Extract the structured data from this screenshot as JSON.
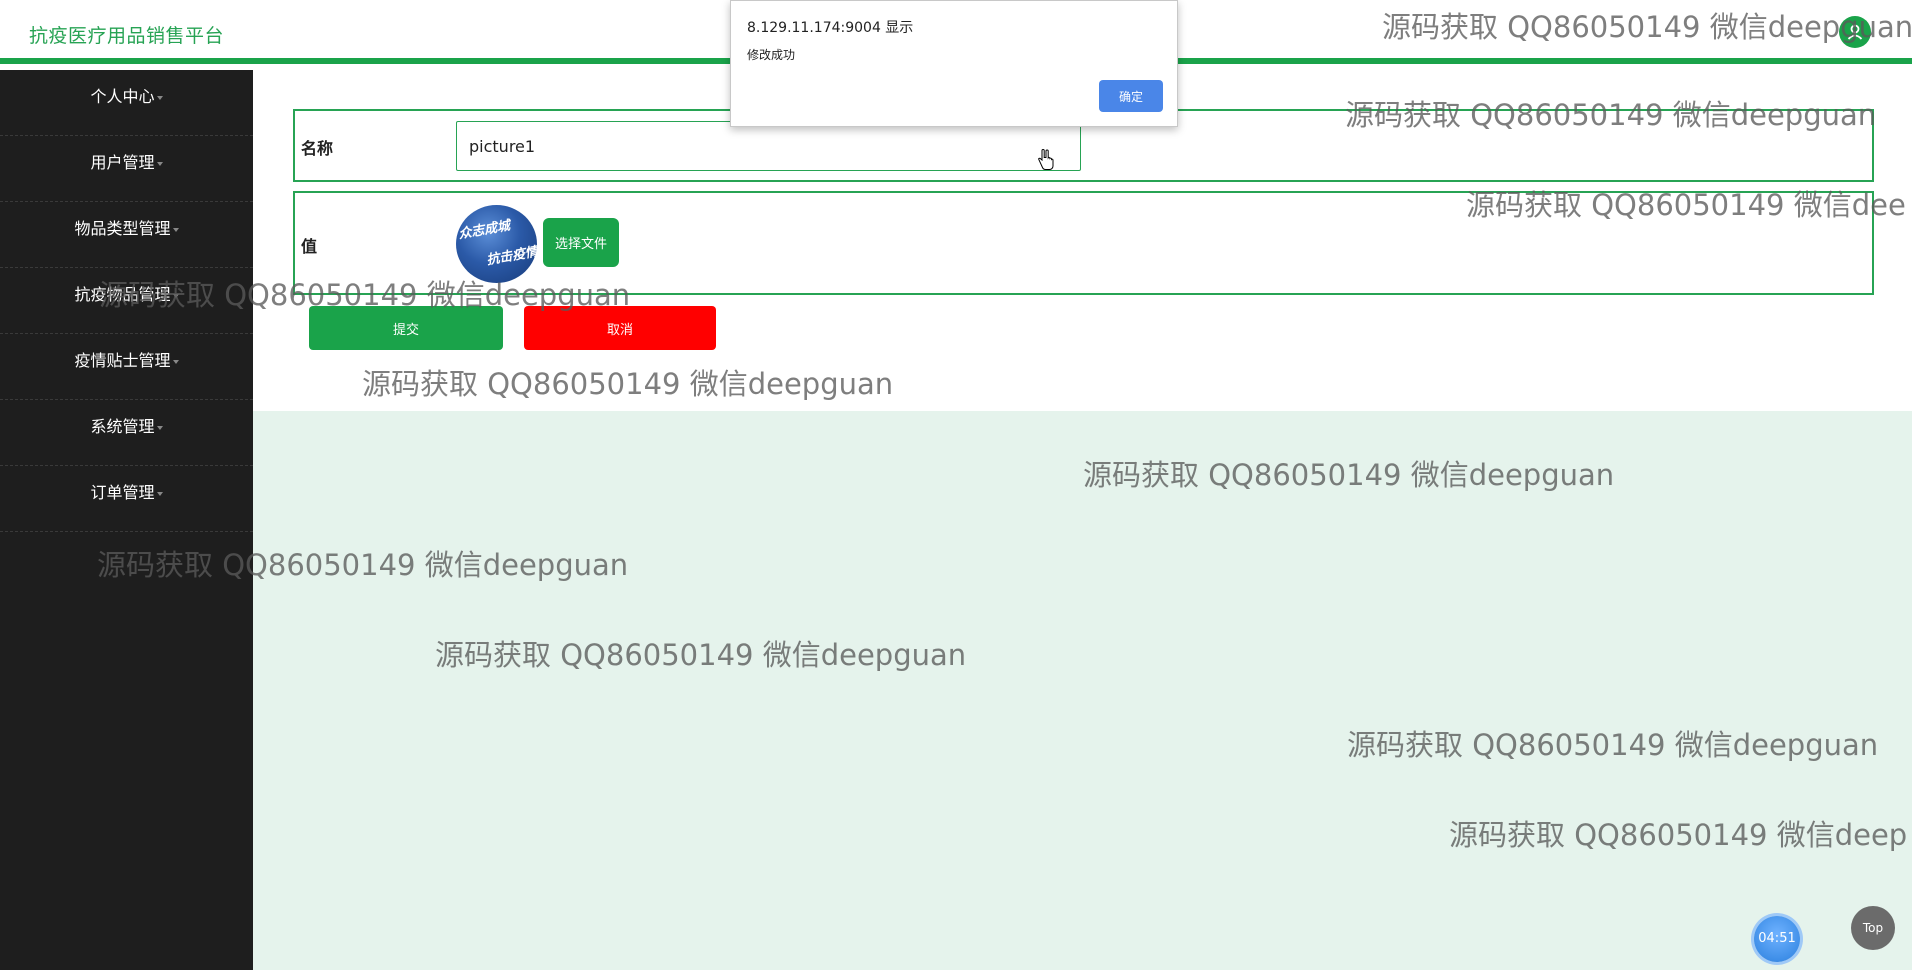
{
  "header": {
    "brand": "抗疫医疗用品销售平台"
  },
  "sidebar": {
    "items": [
      {
        "label": "个人中心"
      },
      {
        "label": "用户管理"
      },
      {
        "label": "物品类型管理"
      },
      {
        "label": "抗疫物品管理"
      },
      {
        "label": "疫情贴士管理"
      },
      {
        "label": "系统管理"
      },
      {
        "label": "订单管理"
      }
    ]
  },
  "form": {
    "name_label": "名称",
    "name_value": "picture1",
    "value_label": "值",
    "image_text_line1": "众志成城",
    "image_text_line2": "抗击疫情",
    "choose_file_label": "选择文件",
    "submit_label": "提交",
    "cancel_label": "取消"
  },
  "dialog": {
    "title": "8.129.11.174:9004 显示",
    "message": "修改成功",
    "ok_label": "确定"
  },
  "timer": "04:51",
  "top_label": "Top",
  "watermarks": [
    "源码获取 QQ86050149 微信deepguan",
    "源码获取 QQ86050149 微信deepguan",
    "源码获取 QQ86050149 微信dee",
    "源码获取 QQ86050149 微信deepguan",
    "源码获取 QQ86050149 微信deepguan",
    "源码获取 QQ86050149 微信deepguan",
    "源码获取 QQ86050149 微信deepguan",
    "源码获取 QQ86050149 微信deepguan",
    "源码获取 QQ86050149 微信deepguan",
    "源码获取 QQ86050149 微信deep"
  ],
  "colors": {
    "accent_green": "#1aa34a",
    "cancel_red": "#ff0000",
    "sidebar_bg": "#1e1e1e",
    "content_bg": "#e5f3ec",
    "dialog_button": "#4a86e8"
  },
  "icons": {
    "avatar": "user-icon",
    "cursor": "hand-pointer-icon"
  }
}
